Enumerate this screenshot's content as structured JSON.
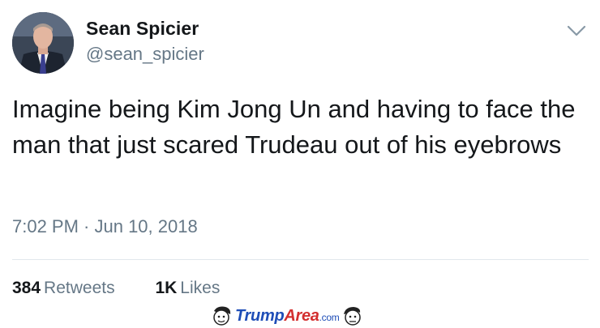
{
  "tweet": {
    "author_name": "Sean Spicier",
    "author_handle": "@sean_spicier",
    "text": "Imagine being Kim Jong Un and having to face the man that just scared Trudeau out of his eyebrows",
    "timestamp": "7:02 PM · Jun 10, 2018",
    "retweets": {
      "count": "384",
      "label": "Retweets"
    },
    "likes": {
      "count": "1K",
      "label": "Likes"
    }
  },
  "icons": {
    "menu": "chevron-down-icon",
    "avatar": "avatar"
  },
  "watermark": {
    "brand_main": "Trump",
    "brand_accent": "Area",
    "brand_suffix": ".com"
  },
  "colors": {
    "text_primary": "#14171a",
    "text_secondary": "#657786",
    "divider": "#e1e8ed",
    "watermark_blue": "#1e4db7",
    "watermark_red": "#d32f2f"
  }
}
